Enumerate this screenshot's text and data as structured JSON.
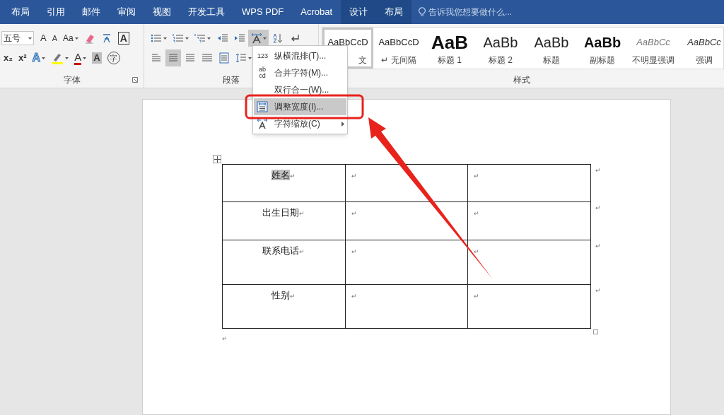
{
  "tabs": [
    {
      "label": "布局",
      "contextual": false
    },
    {
      "label": "引用",
      "contextual": false
    },
    {
      "label": "邮件",
      "contextual": false
    },
    {
      "label": "审阅",
      "contextual": false
    },
    {
      "label": "视图",
      "contextual": false
    },
    {
      "label": "开发工具",
      "contextual": false
    },
    {
      "label": "WPS PDF",
      "contextual": false
    },
    {
      "label": "Acrobat",
      "contextual": false
    },
    {
      "label": "设计",
      "contextual": true
    },
    {
      "label": "布局",
      "contextual": true
    }
  ],
  "tell_me": {
    "placeholder": "告诉我您想要做什么..."
  },
  "ribbon": {
    "groups": [
      {
        "label": "字体",
        "launcher": true,
        "rows": [
          [
            {
              "kind": "size",
              "text": "五号"
            },
            {
              "kind": "grow",
              "text": "A"
            },
            {
              "kind": "shrink",
              "text": "A"
            },
            {
              "kind": "case",
              "text": "Aa"
            },
            {
              "kind": "clear"
            },
            {
              "kind": "phonetic"
            },
            {
              "kind": "border",
              "text": "A"
            }
          ],
          [
            {
              "kind": "sub",
              "text": "x₂"
            },
            {
              "kind": "sup",
              "text": "x²"
            },
            {
              "kind": "effect",
              "text": "A"
            },
            {
              "kind": "highlight"
            },
            {
              "kind": "color",
              "text": "A"
            },
            {
              "kind": "shading",
              "text": "A"
            },
            {
              "kind": "enclose",
              "text": "字"
            }
          ]
        ]
      },
      {
        "label": "段落",
        "launcher": false,
        "rows": [
          [
            {
              "kind": "bullets"
            },
            {
              "kind": "numbering"
            },
            {
              "kind": "multilevel"
            },
            {
              "kind": "outdent"
            },
            {
              "kind": "indent"
            },
            {
              "kind": "asian",
              "active": true
            },
            {
              "kind": "sort"
            },
            {
              "kind": "marks"
            }
          ],
          [
            {
              "kind": "left",
              "active": false
            },
            {
              "kind": "center",
              "active": true
            },
            {
              "kind": "right",
              "active": false
            },
            {
              "kind": "justify",
              "active": false
            },
            {
              "kind": "distribute",
              "active": false
            },
            {
              "kind": "spacing"
            }
          ]
        ]
      }
    ],
    "styles": {
      "label": "样式",
      "items": [
        {
          "sample": "AaBbCcD",
          "name": "文",
          "kind": "normal",
          "selected": true
        },
        {
          "sample": "AaBbCcD",
          "name": "↵ 无间隔",
          "kind": "normal",
          "selected": false
        },
        {
          "sample": "AaB",
          "name": "标题 1",
          "kind": "h1",
          "selected": false
        },
        {
          "sample": "AaBb",
          "name": "标题 2",
          "kind": "h2",
          "selected": false
        },
        {
          "sample": "AaBb",
          "name": "标题",
          "kind": "title",
          "selected": false
        },
        {
          "sample": "AaBb",
          "name": "副标题",
          "kind": "bold",
          "selected": false
        },
        {
          "sample": "AaBbCc",
          "name": "不明显强调",
          "kind": "subtle",
          "selected": false
        },
        {
          "sample": "AaBbCc",
          "name": "强调",
          "kind": "emphasis",
          "selected": false
        }
      ]
    }
  },
  "menu": {
    "items": [
      {
        "label": "纵横混排(T)...",
        "kind": "glyph",
        "glyph": "123",
        "selected": false,
        "submenu": false
      },
      {
        "label": "合并字符(M)...",
        "kind": "glyph",
        "glyph": "ab cd",
        "selected": false,
        "submenu": false
      },
      {
        "label": "双行合一(W)...",
        "kind": "none",
        "selected": false,
        "submenu": false
      },
      {
        "label": "调整宽度(I)...",
        "kind": "fit",
        "selected": true,
        "submenu": false
      },
      {
        "label": "字符缩放(C)",
        "kind": "scale",
        "selected": false,
        "submenu": true
      }
    ]
  },
  "table": {
    "rows": [
      {
        "cells": [
          {
            "text": "姓名",
            "mark": "↵",
            "selected": true
          },
          {
            "mark": "↵"
          },
          {
            "mark": "↵"
          }
        ],
        "end": "↵"
      },
      {
        "cells": [
          {
            "text": "出生日期",
            "mark": "↵",
            "selected": false
          },
          {
            "mark": "↵"
          },
          {
            "mark": "↵"
          }
        ],
        "end": "↵"
      },
      {
        "cells": [
          {
            "text": "联系电话",
            "mark": "↵",
            "selected": false
          },
          {
            "mark": "↵"
          },
          {
            "mark": "↵"
          }
        ],
        "end": "↵"
      },
      {
        "cells": [
          {
            "text": "性别",
            "mark": "↵",
            "selected": false
          },
          {
            "mark": "↵"
          },
          {
            "mark": "↵"
          }
        ],
        "end": "↵"
      }
    ],
    "after": "↵"
  }
}
